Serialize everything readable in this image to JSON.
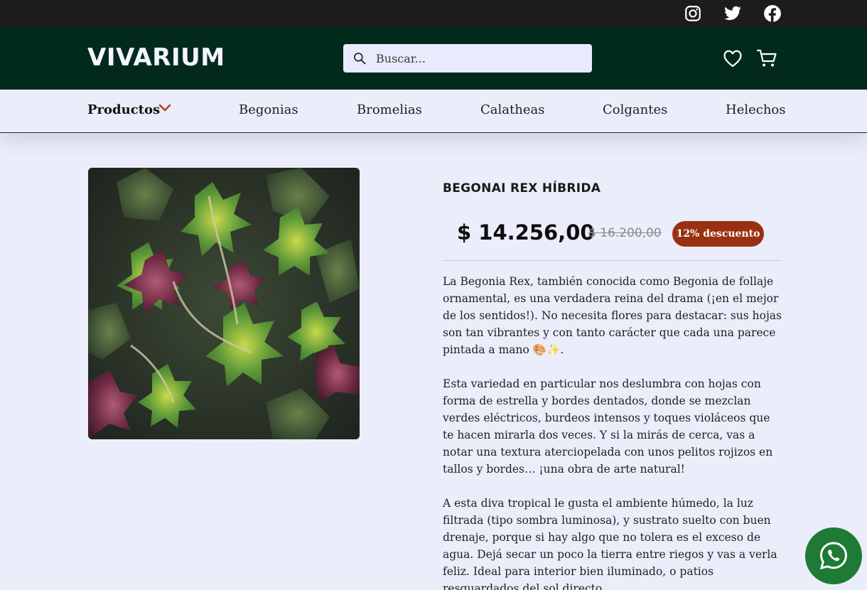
{
  "topbar": {
    "social": [
      {
        "name": "instagram-icon"
      },
      {
        "name": "twitter-icon"
      },
      {
        "name": "facebook-icon"
      }
    ]
  },
  "header": {
    "logo": "VIVARIUM",
    "search_placeholder": "Buscar..."
  },
  "nav": {
    "items": [
      {
        "label": "Productos",
        "has_dropdown": true
      },
      {
        "label": "Begonias"
      },
      {
        "label": "Bromelias"
      },
      {
        "label": "Calatheas"
      },
      {
        "label": "Colgantes"
      },
      {
        "label": "Helechos"
      }
    ]
  },
  "product": {
    "title": "BEGONAI REX HÍBRIDA",
    "price": "$ 14.256,00",
    "old_price": "$ 16.200,00",
    "discount": "12% descuento",
    "description": [
      "La Begonia Rex, también conocida como Begonia de follaje ornamental, es una verdadera reina del drama (¡en el mejor de los sentidos!). No necesita flores para destacar: sus hojas son tan vibrantes y con tanto carácter que cada una parece pintada a mano 🎨✨.",
      "Esta variedad en particular nos deslumbra con hojas con forma de estrella y bordes dentados, donde se mezclan verdes eléctricos, burdeos intensos y toques violáceos que te hacen mirarla dos veces. Y si la mirás de cerca, vas a notar una textura aterciopelada con unos pelitos rojizos en tallos y bordes… ¡una obra de arte natural!",
      "A esta diva tropical le gusta el ambiente húmedo, la luz filtrada (tipo sombra luminosa), y sustrato suelto con buen drenaje, porque si hay algo que no tolera es el exceso de agua. Dejá secar un poco la tierra entre riegos y vas a verla feliz. Ideal para interior bien iluminado, o patios resguardados del sol directo."
    ]
  },
  "colors": {
    "topbar": "#1c1b1d",
    "header": "#022a1c",
    "page_bg": "#ebedfa",
    "discount_badge": "#9a3012",
    "whatsapp": "#1e7a34"
  }
}
